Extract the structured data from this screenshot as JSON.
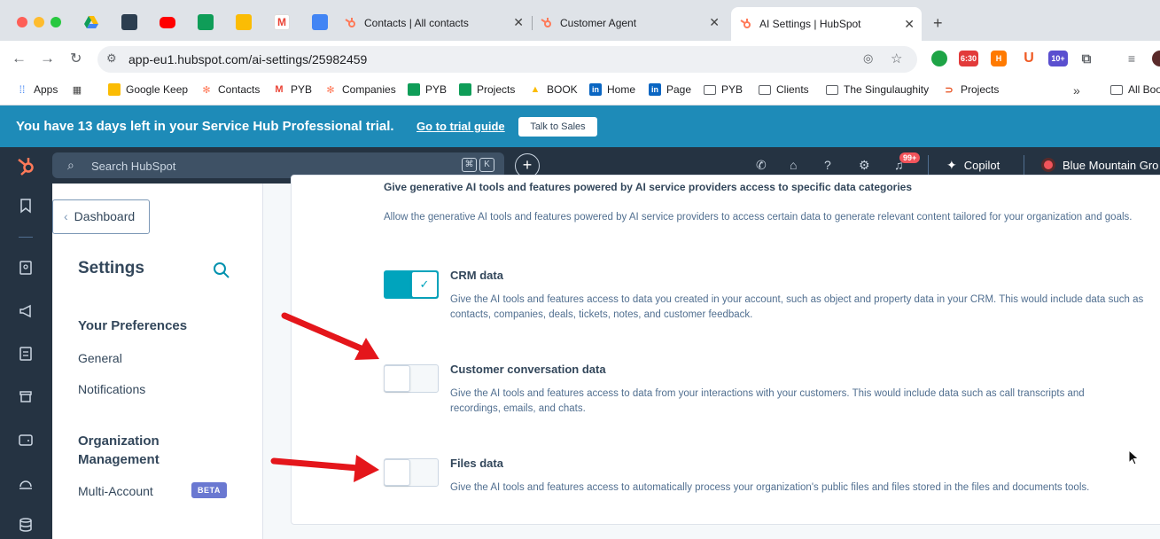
{
  "browser": {
    "tabs": [
      {
        "label": "Contacts | All contacts",
        "active": false
      },
      {
        "label": "Customer Agent",
        "active": false
      },
      {
        "label": "AI Settings | HubSpot",
        "active": true
      }
    ],
    "new_tab": "+",
    "url": "app-eu1.hubspot.com/ai-settings/25982459",
    "extensions": {
      "clock_badge": "6:30",
      "count_badge": "10+"
    },
    "bookmarks": [
      {
        "label": "Apps"
      },
      {
        "label": "Google Keep"
      },
      {
        "label": "Contacts"
      },
      {
        "label": "PYB"
      },
      {
        "label": "Companies"
      },
      {
        "label": "PYB"
      },
      {
        "label": "Projects"
      },
      {
        "label": "BOOK"
      },
      {
        "label": "Home"
      },
      {
        "label": "Page"
      },
      {
        "label": "PYB"
      },
      {
        "label": "Clients"
      },
      {
        "label": "The Singulaughity"
      },
      {
        "label": "Projects"
      },
      {
        "label": "All Bookmarks"
      }
    ]
  },
  "trial_banner": {
    "message": "You have 13 days left in your Service Hub Professional trial.",
    "guide_link": "Go to trial guide",
    "sales_button": "Talk to Sales"
  },
  "topnav": {
    "search_placeholder": "Search HubSpot",
    "shortcut_keys": [
      "⌘",
      "K"
    ],
    "notifications_badge": "99+",
    "copilot_label": "Copilot",
    "account_name": "Blue Mountain Gro"
  },
  "sidebar": {
    "back_button": "Dashboard",
    "title": "Settings",
    "sections": [
      {
        "heading": "Your Preferences",
        "items": [
          "General",
          "Notifications"
        ]
      },
      {
        "heading": "Organization Management",
        "items": [
          "Multi-Account"
        ]
      }
    ],
    "beta_badge": "BETA"
  },
  "main": {
    "section_heading": "Give generative AI tools and features powered by AI service providers access to specific data categories",
    "section_description": "Allow the generative AI tools and features powered by AI service providers to access certain data to generate relevant content tailored for your organization and goals.",
    "options": [
      {
        "title": "CRM data",
        "enabled": true,
        "description": "Give the AI tools and features access to data you created in your account, such as object and property data in your CRM. This would include data such as contacts, companies, deals, tickets, notes, and customer feedback."
      },
      {
        "title": "Customer conversation data",
        "enabled": false,
        "description": "Give the AI tools and features access to data from your interactions with your customers. This would include data such as call transcripts and recordings, emails, and chats."
      },
      {
        "title": "Files data",
        "enabled": false,
        "description": "Give the AI tools and features access to automatically process your organization's public files and files stored in the files and documents tools."
      }
    ]
  },
  "colors": {
    "nav_bg": "#253342",
    "banner_bg": "#1e8bb8",
    "toggle_on": "#00a4bd",
    "annotation_arrow": "#e4161b"
  }
}
